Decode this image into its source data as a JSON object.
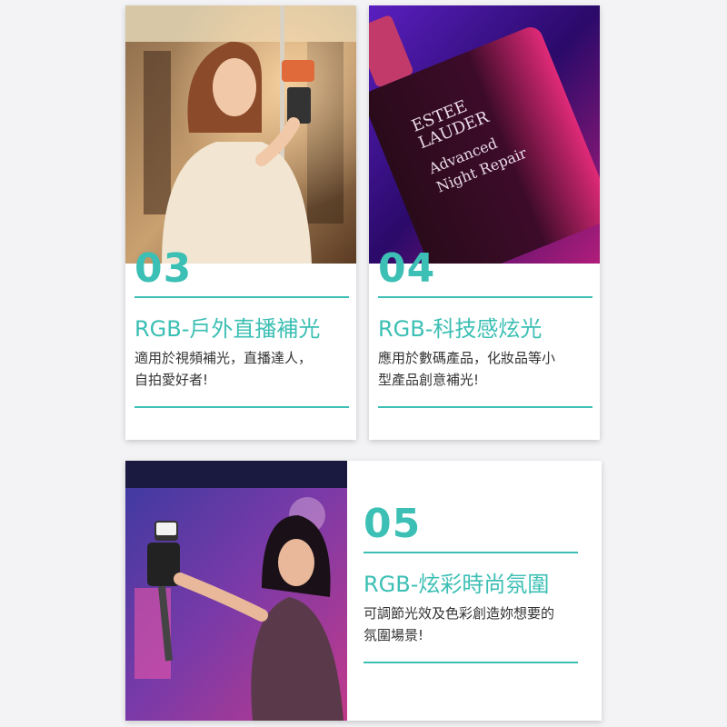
{
  "accent_color": "#3cbfb4",
  "cards": [
    {
      "number": "03",
      "title": "RGB-戶外直播補光",
      "desc_line1": "適用於視頻補光，直播達人，",
      "desc_line2": "自拍愛好者!",
      "photo": "woman-livestreaming-on-subway"
    },
    {
      "number": "04",
      "title": "RGB-科技感炫光",
      "desc_line1": "應用於數碼產品，化妝品等小",
      "desc_line2": "型產品創意補光!",
      "photo": "skincare-bottle-purple-light",
      "bottle_label": {
        "brand_line1": "ESTEE",
        "brand_line2": "LAUDER",
        "product_line1": "Advanced",
        "product_line2": "Night Repair"
      }
    },
    {
      "number": "05",
      "title": "RGB-炫彩時尚氛圍",
      "desc_line1": "可調節光效及色彩創造妳想要的",
      "desc_line2": "氛圍場景!",
      "photo": "woman-filming-neon-street"
    }
  ]
}
